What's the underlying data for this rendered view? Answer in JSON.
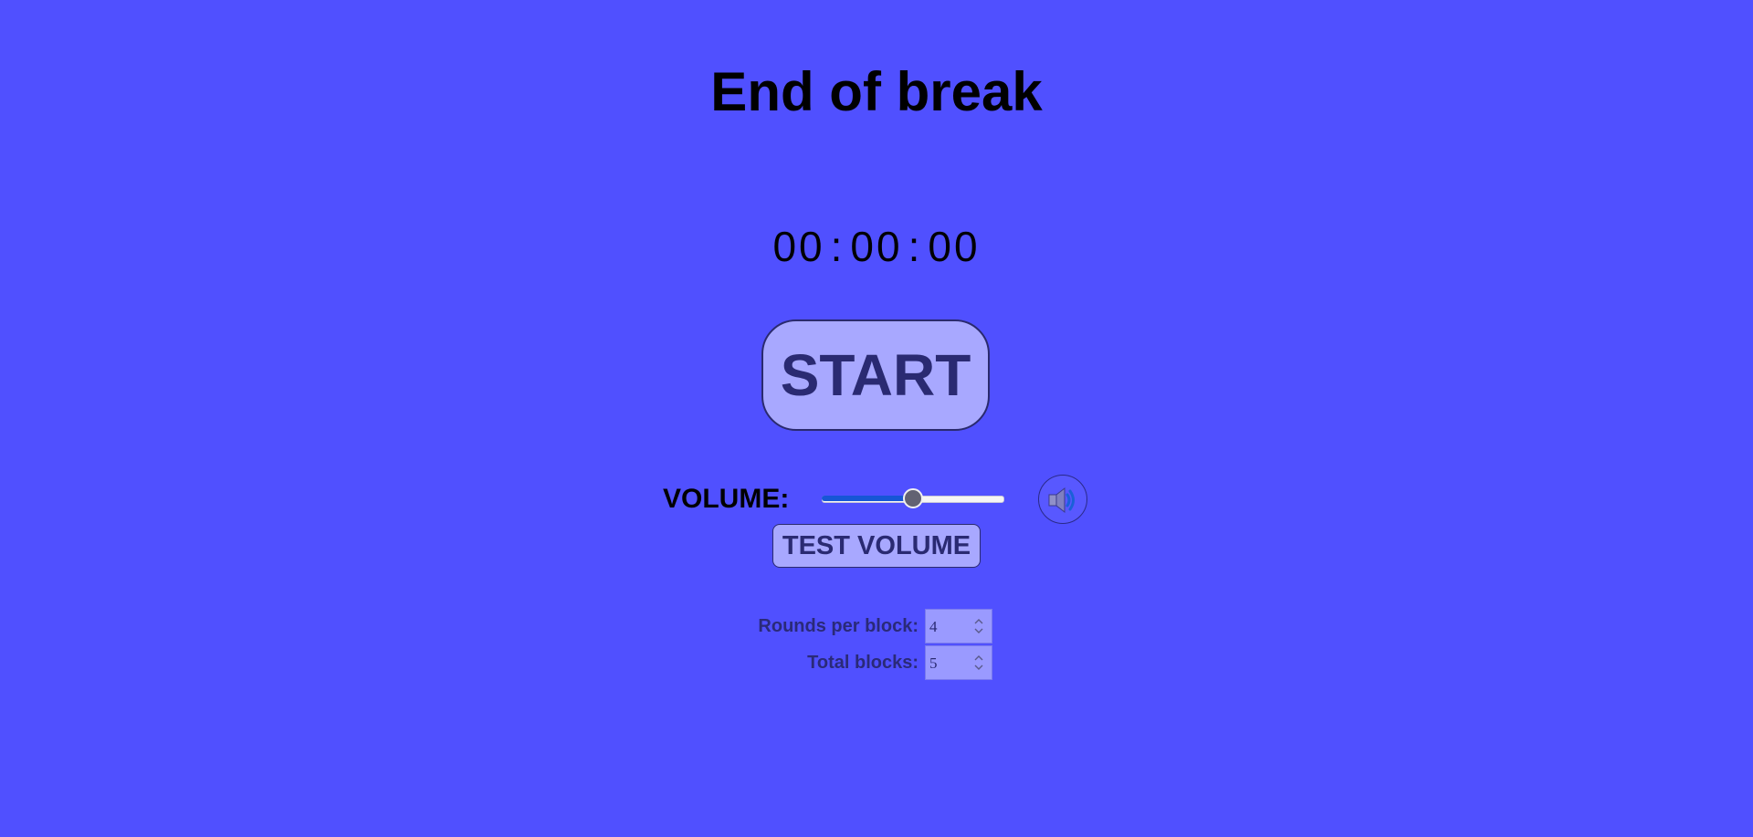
{
  "page": {
    "title": "End of break"
  },
  "timer": {
    "hours": "00",
    "minutes": "00",
    "seconds": "00",
    "separator": ":"
  },
  "controls": {
    "start_label": "START",
    "volume_label": "VOLUME:",
    "volume_level": 0.5,
    "speaker_icon": "speaker-icon",
    "test_volume_label": "TEST VOLUME"
  },
  "settings": {
    "rounds_per_block_label": "Rounds per block:",
    "rounds_per_block_value": "4",
    "total_blocks_label": "Total blocks:",
    "total_blocks_value": "5"
  },
  "colors": {
    "background": "#5050ff",
    "button_fill": "#a8a8ff",
    "button_text": "#2a2a72",
    "slider_fill": "#1756d6"
  }
}
